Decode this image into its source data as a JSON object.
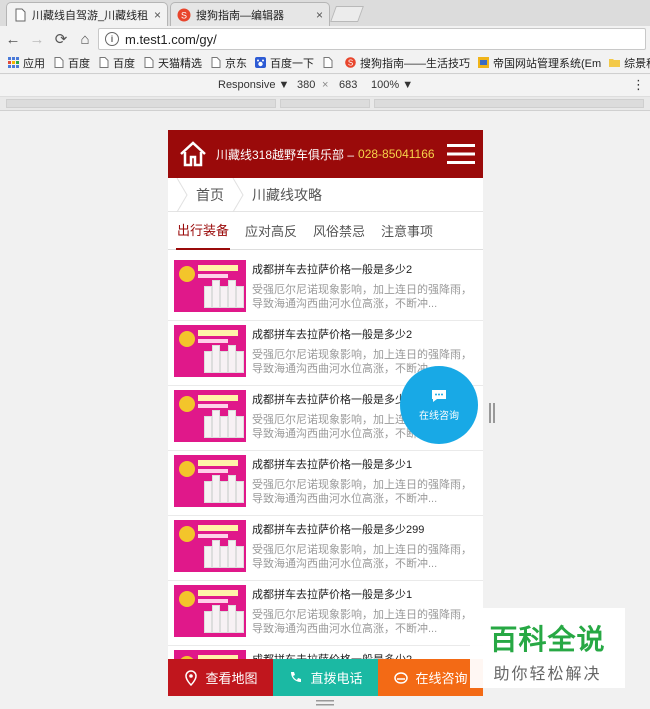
{
  "browser": {
    "tabs": [
      {
        "title": "川藏线自驾游_川藏线租车",
        "close": "×",
        "active": true
      },
      {
        "title": "搜狗指南—编辑器",
        "close": "×",
        "active": false
      }
    ],
    "url": "m.test1.com/gy/",
    "bookmarks": [
      "应用",
      "百度",
      "百度",
      "天猫精选",
      "京东",
      "百度一下",
      "",
      "搜狗指南——生活技巧",
      "帝国网站管理系统(Em",
      "综景租"
    ]
  },
  "devtools": {
    "device": "Responsive ▼",
    "width": "380",
    "times": "×",
    "height": "683",
    "zoom": "100% ▼",
    "more": "⋮"
  },
  "site": {
    "header": {
      "club": "川藏线318越野车俱乐部 –",
      "phone": "028-85041166"
    },
    "breadcrumb": {
      "home": "首页",
      "current": "川藏线攻略"
    },
    "tabs": [
      "出行装备",
      "应对高反",
      "风俗禁忌",
      "注意事项"
    ],
    "articles": [
      {
        "title": "成都拼车去拉萨价格一般是多少2",
        "desc": "受强厄尔尼诺现象影响，加上连日的强降雨，导致海通沟西曲河水位高涨，不断冲..."
      },
      {
        "title": "成都拼车去拉萨价格一般是多少2",
        "desc": "受强厄尔尼诺现象影响，加上连日的强降雨，导致海通沟西曲河水位高涨，不断冲..."
      },
      {
        "title": "成都拼车去拉萨价格一般是多少2",
        "desc": "受强厄尔尼诺现象影响，加上连日的强降雨，导致海通沟西曲河水位高涨，不断冲..."
      },
      {
        "title": "成都拼车去拉萨价格一般是多少1",
        "desc": "受强厄尔尼诺现象影响，加上连日的强降雨，导致海通沟西曲河水位高涨，不断冲..."
      },
      {
        "title": "成都拼车去拉萨价格一般是多少299",
        "desc": "受强厄尔尼诺现象影响，加上连日的强降雨，导致海通沟西曲河水位高涨，不断冲..."
      },
      {
        "title": "成都拼车去拉萨价格一般是多少1",
        "desc": "受强厄尔尼诺现象影响，加上连日的强降雨，导致海通沟西曲河水位高涨，不断冲..."
      },
      {
        "title": "成都拼车去拉萨价格一般是多少2",
        "desc": ""
      }
    ],
    "float_consult": "在线咨询",
    "bottom": [
      {
        "label": "查看地图",
        "color": "#c0161d"
      },
      {
        "label": "直拨电话",
        "color": "#1bb9a3"
      },
      {
        "label": "在线咨询",
        "color": "#f36a15"
      }
    ]
  },
  "watermark": {
    "big": "百科全说",
    "small": "助你轻松解决"
  },
  "colors": {
    "brand_red": "#9a0a0a",
    "phone_yellow": "#f6d24a",
    "float_blue": "#18a9e6"
  }
}
